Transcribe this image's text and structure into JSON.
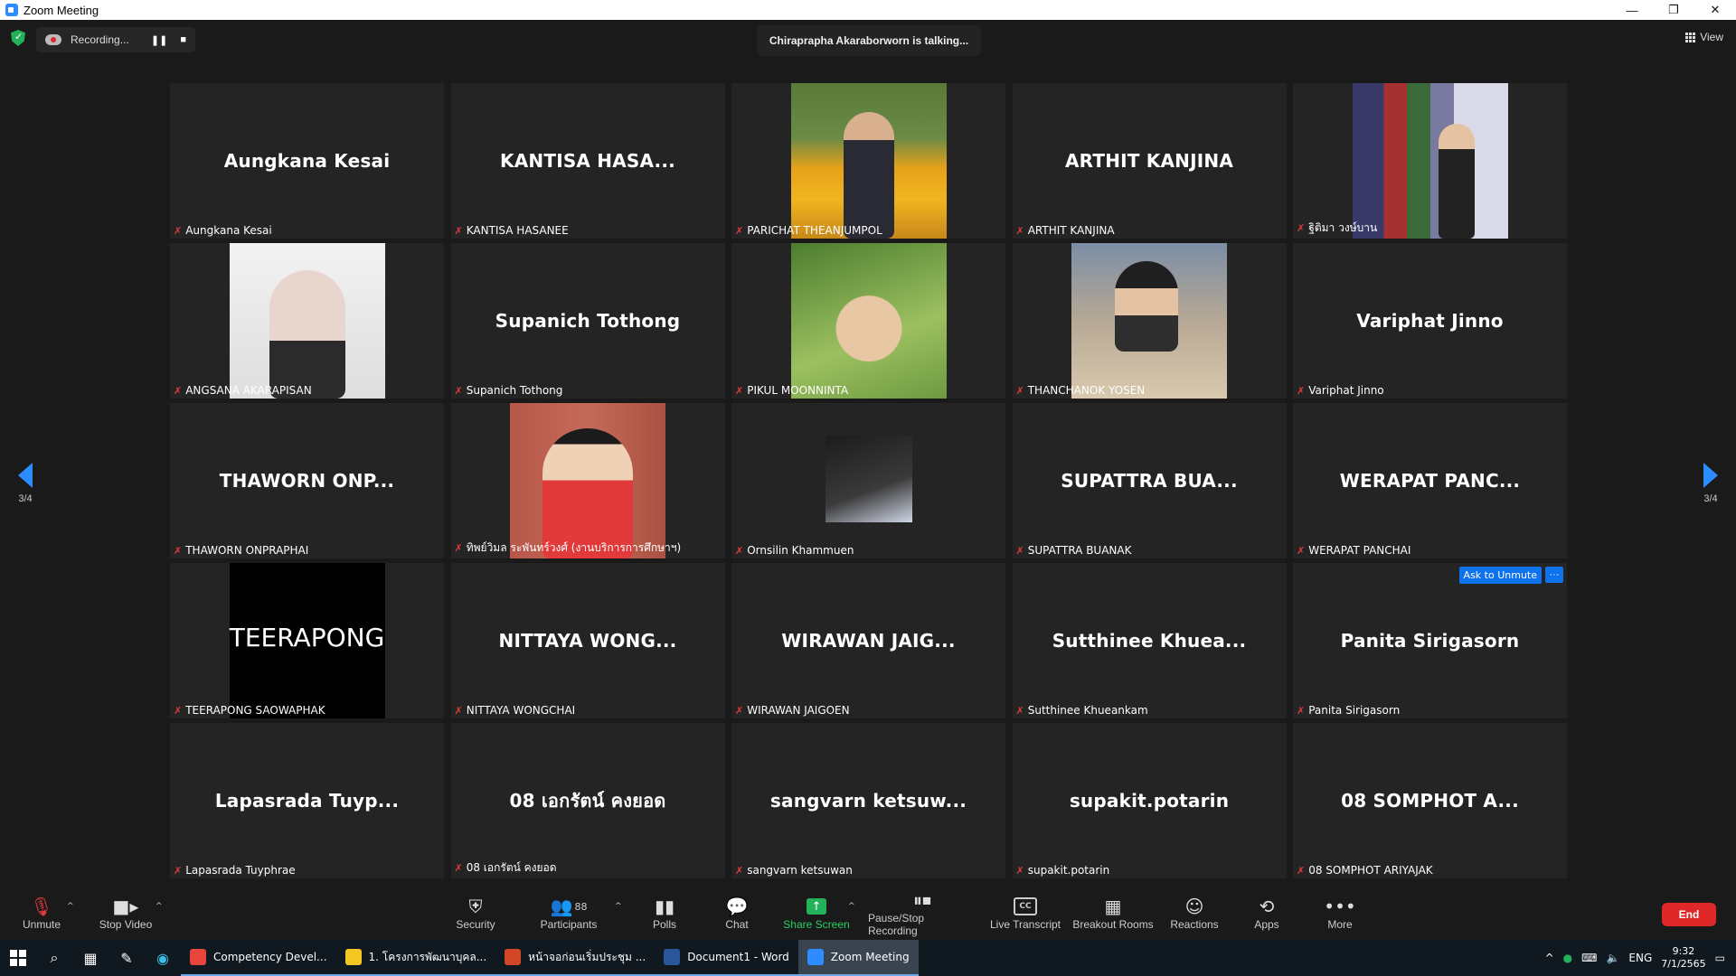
{
  "window": {
    "title": "Zoom Meeting",
    "minimize": "—",
    "restore": "❐",
    "close": "✕"
  },
  "top": {
    "recording_label": "Recording...",
    "pause_glyph": "❚❚",
    "stop_glyph": "■",
    "talking": "Chiraprapha Akaraborworn is talking...",
    "view_label": "View"
  },
  "pager": {
    "left": "3/4",
    "right": "3/4"
  },
  "tiles": [
    {
      "big": "Aungkana Kesai",
      "label": "Aungkana Kesai",
      "photo": ""
    },
    {
      "big": "KANTISA  HASA...",
      "label": "KANTISA HASANEE",
      "photo": ""
    },
    {
      "big": "",
      "label": "PARICHAT THEANJUMPOL",
      "photo": "flowers"
    },
    {
      "big": "ARTHIT KANJINA",
      "label": "ARTHIT KANJINA",
      "photo": ""
    },
    {
      "big": "",
      "label": "ฐิติมา วงษ์บาน",
      "photo": "shelf"
    },
    {
      "big": "",
      "label": "ANGSANA AKARAPISAN",
      "photo": "hijab"
    },
    {
      "big": "Supanich Tothong",
      "label": "Supanich Tothong",
      "photo": ""
    },
    {
      "big": "",
      "label": "PIKUL MOONNINTA",
      "photo": "garden"
    },
    {
      "big": "",
      "label": "THANCHANOK YOSEN",
      "photo": "camera"
    },
    {
      "big": "Variphat Jinno",
      "label": "Variphat Jinno",
      "photo": ""
    },
    {
      "big": "THAWORN  ONP...",
      "label": "THAWORN ONPRAPHAI",
      "photo": ""
    },
    {
      "big": "",
      "label": "ทิพย์วิมล ระพันทร์วงศ์ (งานบริการการศึกษาฯ)",
      "photo": "red"
    },
    {
      "big": "",
      "label": "Ornsilin Khammuen",
      "photo": "small"
    },
    {
      "big": "SUPATTRA  BUA...",
      "label": "SUPATTRA BUANAK",
      "photo": ""
    },
    {
      "big": "WERAPAT  PANC...",
      "label": "WERAPAT PANCHAI",
      "photo": ""
    },
    {
      "big": "",
      "label": "TEERAPONG SAOWAPHAK",
      "photo": "black",
      "photo_text": "TEERAPONG"
    },
    {
      "big": "NITTAYA  WONG...",
      "label": "NITTAYA WONGCHAI",
      "photo": ""
    },
    {
      "big": "WIRAWAN  JAIG...",
      "label": "WIRAWAN JAIGOEN",
      "photo": ""
    },
    {
      "big": "Sutthinee  Khuea...",
      "label": "Sutthinee Khueankam",
      "photo": ""
    },
    {
      "big": "Panita Sirigasorn",
      "label": "Panita Sirigasorn",
      "photo": "",
      "ask_unmute": "Ask to Unmute"
    },
    {
      "big": "Lapasrada  Tuyp...",
      "label": "Lapasrada  Tuyphrae",
      "photo": ""
    },
    {
      "big": "08 เอกรัตน์ คงยอด",
      "label": "08 เอกรัตน์ คงยอด",
      "photo": ""
    },
    {
      "big": "sangvarn  ketsuw...",
      "label": "sangvarn ketsuwan",
      "photo": ""
    },
    {
      "big": "supakit.potarin",
      "label": "supakit.potarin",
      "photo": ""
    },
    {
      "big": "08 SOMPHOT  A...",
      "label": "08 SOMPHOT ARIYAJAK",
      "photo": ""
    }
  ],
  "toolbar": {
    "unmute": "Unmute",
    "stop_video": "Stop Video",
    "security": "Security",
    "participants": "Participants",
    "participants_count": "88",
    "polls": "Polls",
    "chat": "Chat",
    "share_screen": "Share Screen",
    "pause_stop_recording": "Pause/Stop Recording",
    "live_transcript": "Live Transcript",
    "cc_glyph": "CC",
    "breakout_rooms": "Breakout Rooms",
    "reactions": "Reactions",
    "apps": "Apps",
    "more": "More",
    "end": "End"
  },
  "taskbar": {
    "apps": [
      {
        "label": "Competency Devel...",
        "color": "#e8453c"
      },
      {
        "label": "1. โครงการพัฒนาบุคล...",
        "color": "#f3c623"
      },
      {
        "label": "หน้าจอก่อนเริ่มประชุม ...",
        "color": "#d24726"
      },
      {
        "label": "Document1 - Word",
        "color": "#2b579a"
      },
      {
        "label": "Zoom Meeting",
        "color": "#2d8cff"
      }
    ],
    "lang": "ENG",
    "time": "9:32",
    "date": "7/1/2565"
  },
  "colors": {
    "accent": "#2d8cff",
    "end": "#e02828",
    "share": "#23b25a",
    "muted": "#e23b3b"
  }
}
